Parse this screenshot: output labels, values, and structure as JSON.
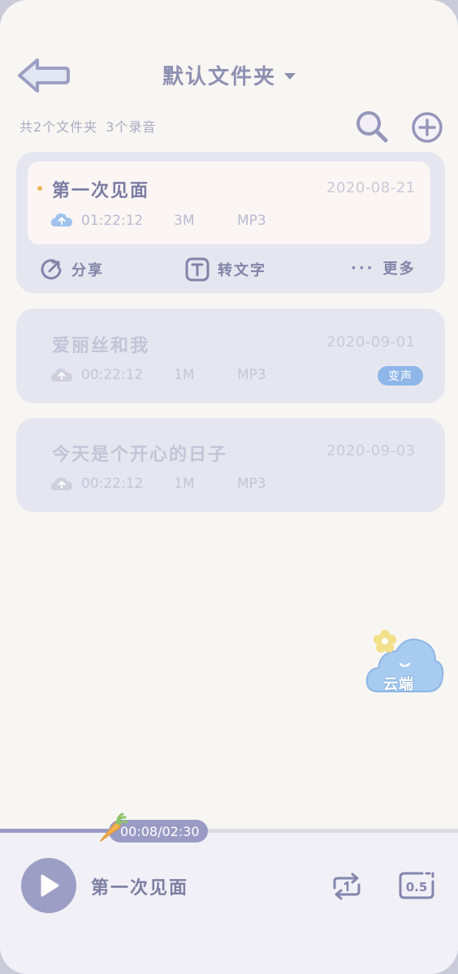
{
  "header": {
    "title": "默认文件夹",
    "folder_count_text": "共2个文件夹",
    "recording_count_text": "3个录音"
  },
  "recordings": [
    {
      "title": "第一次见面",
      "date": "2020-08-21",
      "duration": "01:22:12",
      "size": "3M",
      "format": "MP3",
      "active": true
    },
    {
      "title": "爱丽丝和我",
      "date": "2020-09-01",
      "duration": "00:22:12",
      "size": "1M",
      "format": "MP3",
      "badge": "变声"
    },
    {
      "title": "今天是个开心的日子",
      "date": "2020-09-03",
      "duration": "00:22:12",
      "size": "1M",
      "format": "MP3"
    }
  ],
  "actions": {
    "share": "分享",
    "transcribe": "转文字",
    "more_dots": "···",
    "more": "更多"
  },
  "cloud_fab": {
    "label": "云端"
  },
  "player": {
    "time": "00:08/02:30",
    "progress": 0.24,
    "now_playing": "第一次见面",
    "speed": "0.5"
  },
  "colors": {
    "accent": "#9a9bc4",
    "title_active": "#7a7ca4",
    "title_inactive": "#c3c4d7",
    "badge": "#8fb6e8",
    "dot": "#f0b45a"
  }
}
